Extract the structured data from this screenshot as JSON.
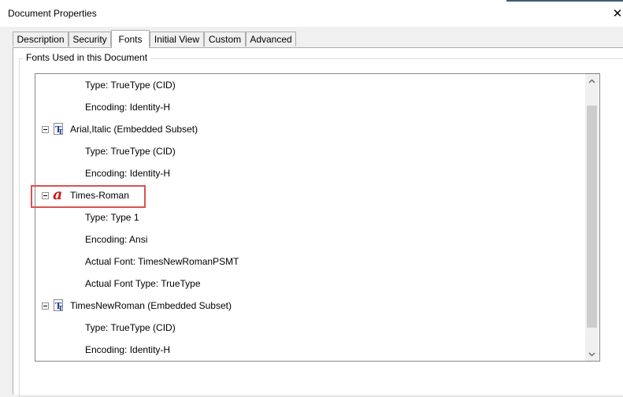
{
  "window": {
    "title": "Document Properties",
    "close_glyph": "✕"
  },
  "tabs": [
    {
      "label": "Description",
      "active": false
    },
    {
      "label": "Security",
      "active": false
    },
    {
      "label": "Fonts",
      "active": true
    },
    {
      "label": "Initial View",
      "active": false
    },
    {
      "label": "Custom",
      "active": false
    },
    {
      "label": "Advanced",
      "active": false
    }
  ],
  "group": {
    "title": "Fonts Used in this Document"
  },
  "tree": {
    "rows": [
      {
        "kind": "property",
        "text": "Type: TrueType (CID)"
      },
      {
        "kind": "property",
        "text": "Encoding: Identity-H"
      },
      {
        "kind": "font",
        "icon": "truetype-font-icon",
        "text": "Arial,Italic (Embedded Subset)"
      },
      {
        "kind": "property",
        "text": "Type: TrueType (CID)"
      },
      {
        "kind": "property",
        "text": "Encoding: Identity-H"
      },
      {
        "kind": "font",
        "icon": "type1-font-icon",
        "text": "Times-Roman",
        "highlighted": true
      },
      {
        "kind": "property",
        "text": "Type: Type 1"
      },
      {
        "kind": "property",
        "text": "Encoding: Ansi"
      },
      {
        "kind": "property",
        "text": "Actual Font: TimesNewRomanPSMT"
      },
      {
        "kind": "property",
        "text": "Actual Font Type: TrueType"
      },
      {
        "kind": "font",
        "icon": "truetype-font-icon",
        "text": "TimesNewRoman (Embedded Subset)"
      },
      {
        "kind": "property",
        "text": "Type: TrueType (CID)"
      },
      {
        "kind": "property",
        "text": "Encoding: Identity-H"
      }
    ]
  },
  "colors": {
    "highlight_border": "#d9534f",
    "type1_icon": "#d01c1c",
    "truetype_icon": "#1a3fa0"
  }
}
